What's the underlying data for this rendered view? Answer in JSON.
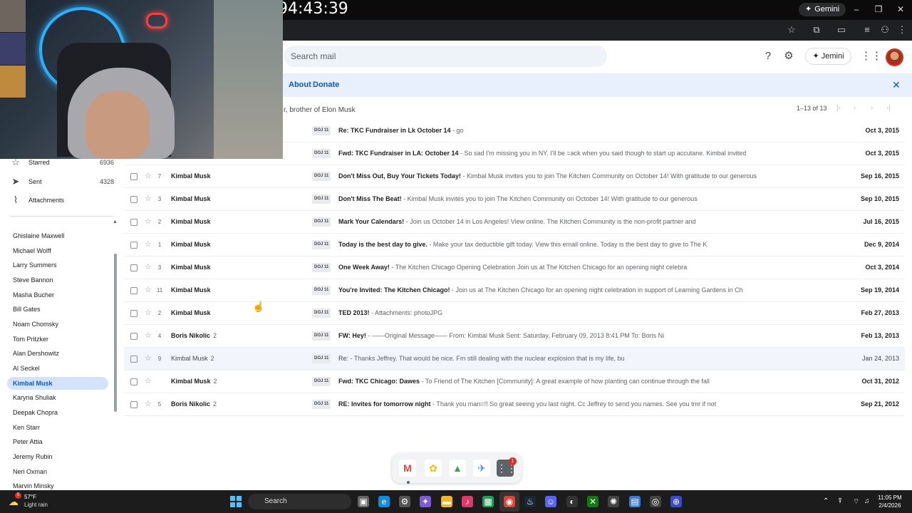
{
  "browser": {
    "timer": "94:43:39",
    "gemini_label": "Gemini"
  },
  "gmail": {
    "search_placeholder": "Search mail",
    "jemini_label": "Jemini",
    "banner": {
      "about": "About",
      "separator": "·",
      "donate": "Donate"
    },
    "sidebar": {
      "starred": {
        "label": "Starred",
        "count": "6936"
      },
      "sent": {
        "label": "Sent",
        "count": "4328"
      },
      "attachments": {
        "label": "Attachments"
      },
      "labels": [
        "Ghislaine Maxwell",
        "Michael Wolff",
        "Larry Summers",
        "Steve Bannon",
        "Masha Bucher",
        "Bill Gates",
        "Noam Chomsky",
        "Tom Pritzker",
        "Alan Dershowitz",
        "Al Seckel",
        "Kimbal Musk",
        "Karyna Shuliak",
        "Deepak Chopra",
        "Ken Starr",
        "Peter Attia",
        "Jeremy Rubin",
        "Neri Oxman",
        "Marvin Minsky"
      ],
      "active_label": "Kimbal Musk"
    },
    "list": {
      "label_description": "r, brother of Elon Musk",
      "page_count": "1–13 of 13",
      "rows": [
        {
          "num": "",
          "sender": "",
          "count": "",
          "tag": "DOJ 11",
          "subject": "Re: TKC Fundraiser in Lk October 14",
          "snippet": " - go",
          "date": "Oct 3, 2015",
          "unread": true
        },
        {
          "num": "",
          "sender": "",
          "count": "",
          "tag": "DOJ 11",
          "subject": "Fwd: TKC Fundraiser in LA: October 14",
          "snippet": " - So sad I'm missing you in NY. I'll be =ack when you said though to start up accutane. Kimbal invited",
          "date": "Oct 3, 2015",
          "unread": true
        },
        {
          "num": "7",
          "sender": "Kimbal Musk",
          "count": "",
          "tag": "DOJ 11",
          "subject": "Don't Miss Out, Buy Your Tickets Today!",
          "snippet": " - Kimbal Musk invites you to join The Kitchen Community on October 14! With gratitude to our generous",
          "date": "Sep 16, 2015",
          "unread": true
        },
        {
          "num": "3",
          "sender": "Kimbal Musk",
          "count": "",
          "tag": "DOJ 11",
          "subject": "Don't Miss The Beat!",
          "snippet": " - Kimbal Musk invites you to join The Kitchen Community on October 14! With gratitude to our generous",
          "date": "Sep 10, 2015",
          "unread": true
        },
        {
          "num": "2",
          "sender": "Kimbal Musk",
          "count": "",
          "tag": "DOJ 11",
          "subject": "Mark Your Calendars!",
          "snippet": " - Join us October 14 in Los Angeles! View online. The Kitchen Community is the non-profit partner and",
          "date": "Jul 16, 2015",
          "unread": true
        },
        {
          "num": "1",
          "sender": "Kimbal Musk",
          "count": "",
          "tag": "DOJ 11",
          "subject": "Today is the best day to give.",
          "snippet": " - Make your tax deductible gift today. View this email online. Today is the best day to give to The K",
          "date": "Dec 9, 2014",
          "unread": true
        },
        {
          "num": "3",
          "sender": "Kimbal Musk",
          "count": "",
          "tag": "DOJ 11",
          "subject": "One Week Away!",
          "snippet": " - The Kitchen Chicago Opening Celebration Join us at The Kitchen Chicago for an opening night celebra",
          "date": "Oct 3, 2014",
          "unread": true
        },
        {
          "num": "11",
          "sender": "Kimbal Musk",
          "count": "",
          "tag": "DOJ 11",
          "subject": "You're Invited: The Kitchen Chicago!",
          "snippet": " - Join us at The Kitchen Chicago for an opening night celebration in support of Learning Gardens in Ch",
          "date": "Sep 19, 2014",
          "unread": true
        },
        {
          "num": "2",
          "sender": "Kimbal Musk",
          "count": "",
          "tag": "DOJ 11",
          "subject": "TED 2013!",
          "snippet": " - Attachments: photoJPG",
          "date": "Feb 27, 2013",
          "unread": true
        },
        {
          "num": "4",
          "sender": "Boris Nikolic",
          "count": "2",
          "tag": "DOJ 11",
          "subject": "FW: Hey!",
          "snippet": " - ——Original Message—— From: Kimbal Musk Sent: Saturday, February 09, 2013 8:41 PM To: Boris Ni",
          "date": "Feb 13, 2013",
          "unread": true
        },
        {
          "num": "9",
          "sender": "Kimbal Musk",
          "count": "2",
          "tag": "DOJ 11",
          "subject": "Re:",
          "snippet": " - Thanks Jeffrey. That would be nice. Fm still dealing with the nuclear explosion that is my life, bu",
          "date": "Jan 24, 2013",
          "unread": false
        },
        {
          "num": "",
          "sender": "Kimbal Musk",
          "count": "2",
          "tag": "DOJ 11",
          "subject": "Fwd: TKC Chicago: Dawes",
          "snippet": " - To Friend of The Kitchen [Community]: A great example of how planting can continue through the fall",
          "date": "Oct 31, 2012",
          "unread": true
        },
        {
          "num": "5",
          "sender": "Boris Nikolic",
          "count": "2",
          "tag": "DOJ 11",
          "subject": "RE: Invites for tomorrow night",
          "snippet": " - Thank you man=!! So great seeing you last night. Cc Jeffrey to send you names. See you tmr if not",
          "date": "Sep 21, 2012",
          "unread": true
        }
      ]
    }
  },
  "dock": {
    "badge": "1"
  },
  "taskbar": {
    "weather_badge": "5",
    "temperature": "57°F",
    "condition": "Light rain",
    "search_label": "Search",
    "time": "11:05 PM",
    "date": "2/4/2026"
  },
  "colors": {
    "accent": "#0b57d0",
    "active_label_bg": "#d3e3fd",
    "banner_bg": "#e8f0fe"
  }
}
